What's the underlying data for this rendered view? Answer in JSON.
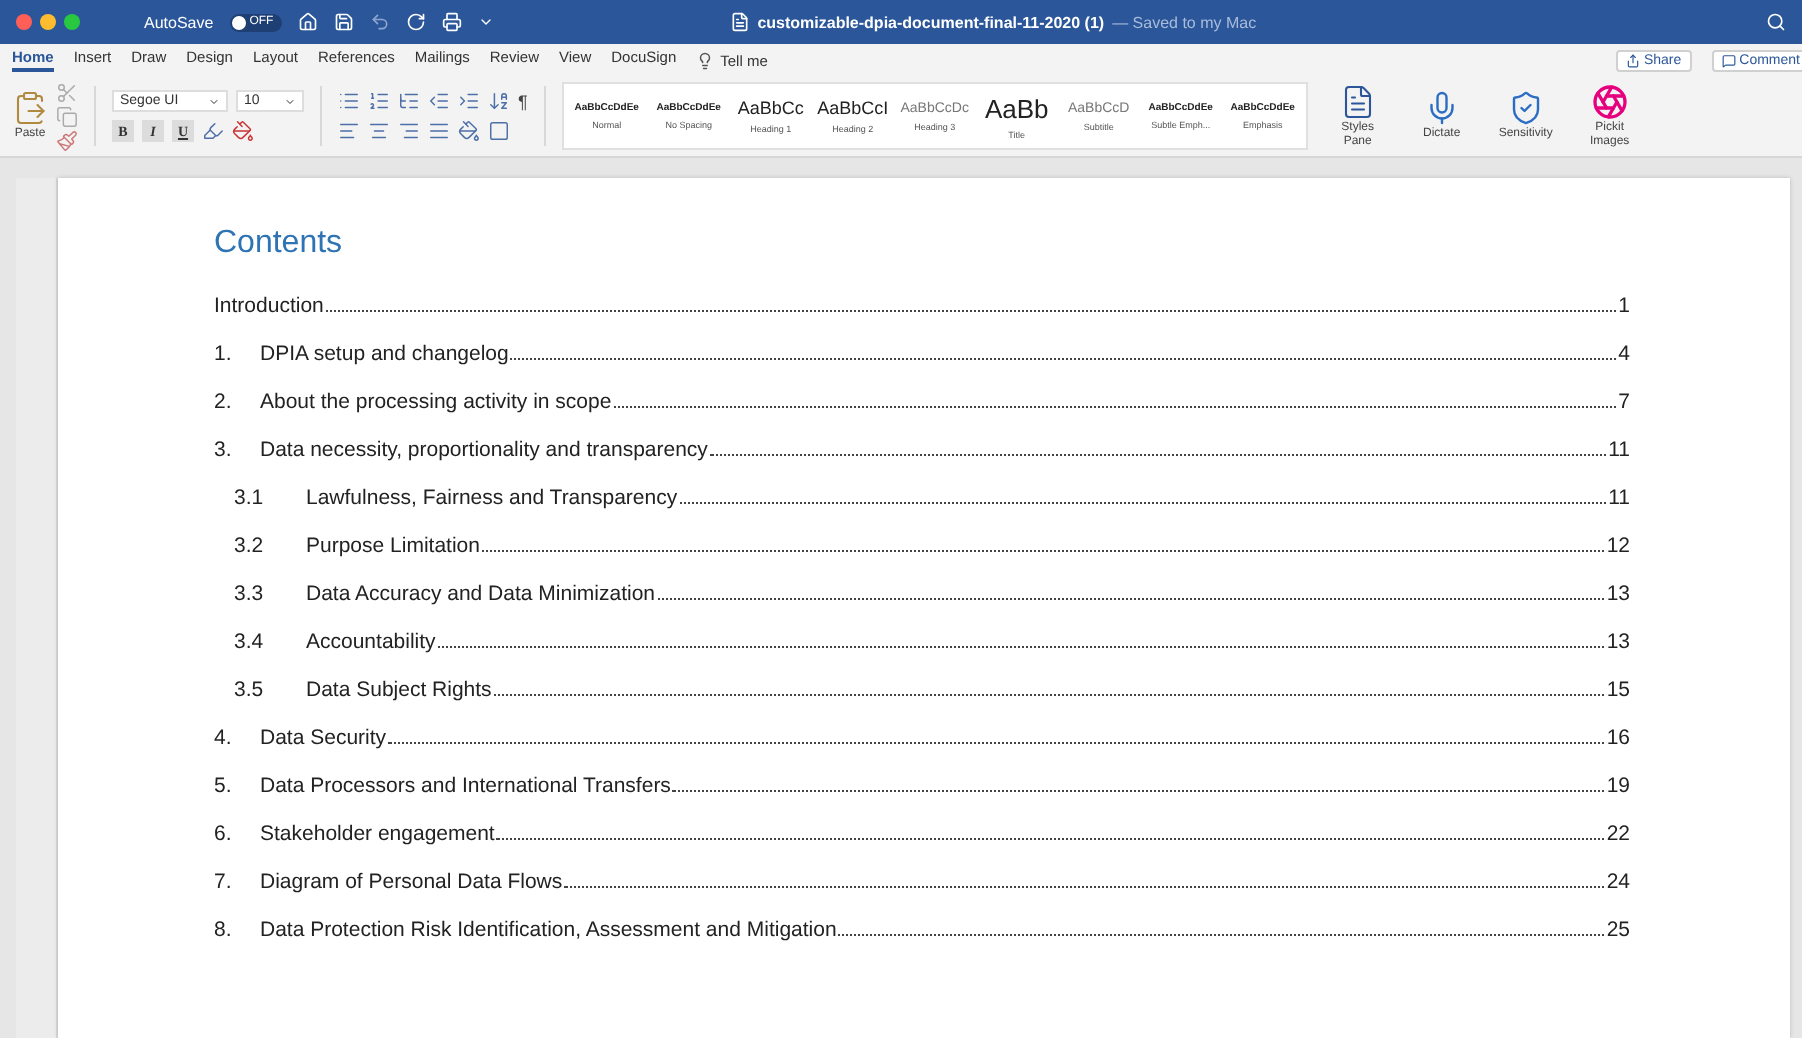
{
  "window": {
    "title": "customizable-dpia-document-final-11-2020 (1)",
    "subtitle": "— Saved to my Mac"
  },
  "autosave": {
    "label": "AutoSave",
    "toggle_text": "OFF",
    "on": false
  },
  "tabs": [
    {
      "label": "Home",
      "selected": true
    },
    {
      "label": "Insert",
      "selected": false
    },
    {
      "label": "Draw",
      "selected": false
    },
    {
      "label": "Design",
      "selected": false
    },
    {
      "label": "Layout",
      "selected": false
    },
    {
      "label": "References",
      "selected": false
    },
    {
      "label": "Mailings",
      "selected": false
    },
    {
      "label": "Review",
      "selected": false
    },
    {
      "label": "View",
      "selected": false
    },
    {
      "label": "DocuSign",
      "selected": false
    }
  ],
  "tell_me": "Tell me",
  "share": "Share",
  "comments": "Comment",
  "ribbon": {
    "paste": "Paste",
    "font": "Segoe UI",
    "size": "10",
    "pilcrow": "¶",
    "format_buttons": [
      {
        "label": "B",
        "kind": "bold"
      },
      {
        "label": "I",
        "kind": "italic"
      },
      {
        "label": "U",
        "kind": "underline"
      }
    ],
    "styles": [
      {
        "preview": "AaBbCcDdEe",
        "name": "Normal",
        "kind": "small"
      },
      {
        "preview": "AaBbCcDdEe",
        "name": "No Spacing",
        "kind": "small"
      },
      {
        "preview": "AaBbCc",
        "name": "Heading 1",
        "kind": "heading"
      },
      {
        "preview": "AaBbCcI",
        "name": "Heading 2",
        "kind": "heading"
      },
      {
        "preview": "AaBbCcDc",
        "name": "Heading 3",
        "kind": "light"
      },
      {
        "preview": "AaBb",
        "name": "Title",
        "kind": "title"
      },
      {
        "preview": "AaBbCcD",
        "name": "Subtitle",
        "kind": "light"
      },
      {
        "preview": "AaBbCcDdEe",
        "name": "Subtle Emph...",
        "kind": "small"
      },
      {
        "preview": "AaBbCcDdEe",
        "name": "Emphasis",
        "kind": "small"
      }
    ],
    "tools": [
      {
        "label": "Styles Pane",
        "kind": "styles"
      },
      {
        "label": "Dictate",
        "kind": "dictate"
      },
      {
        "label": "Sensitivity",
        "kind": "sensitivity"
      },
      {
        "label": "Pickit Images",
        "kind": "pickit"
      }
    ]
  },
  "document": {
    "heading": "Contents",
    "toc": [
      {
        "title": "Introduction",
        "page": "1"
      },
      {
        "number": "1.",
        "title": "DPIA setup and changelog",
        "page": "4"
      },
      {
        "number": "2.",
        "title": "About the processing activity in scope",
        "page": "7"
      },
      {
        "number": "3.",
        "title": "Data necessity, proportionality and transparency",
        "page": "11",
        "children": [
          {
            "number": "3.1",
            "title": "Lawfulness, Fairness and Transparency",
            "page": "11"
          },
          {
            "number": "3.2",
            "title": "Purpose Limitation",
            "page": "12"
          },
          {
            "number": "3.3",
            "title": "Data Accuracy and Data Minimization",
            "page": "13"
          },
          {
            "number": "3.4",
            "title": "Accountability",
            "page": "13"
          },
          {
            "number": "3.5",
            "title": "Data Subject Rights",
            "page": "15"
          }
        ]
      },
      {
        "number": "4.",
        "title": "Data Security",
        "page": "16"
      },
      {
        "number": "5.",
        "title": "Data Processors and International Transfers",
        "page": "19"
      },
      {
        "number": "6.",
        "title": "Stakeholder engagement",
        "page": "22"
      },
      {
        "number": "7.",
        "title": "Diagram of Personal Data Flows",
        "page": "24"
      },
      {
        "number": "8.",
        "title": "Data Protection Risk Identification, Assessment and Mitigation",
        "page": "25"
      }
    ]
  }
}
